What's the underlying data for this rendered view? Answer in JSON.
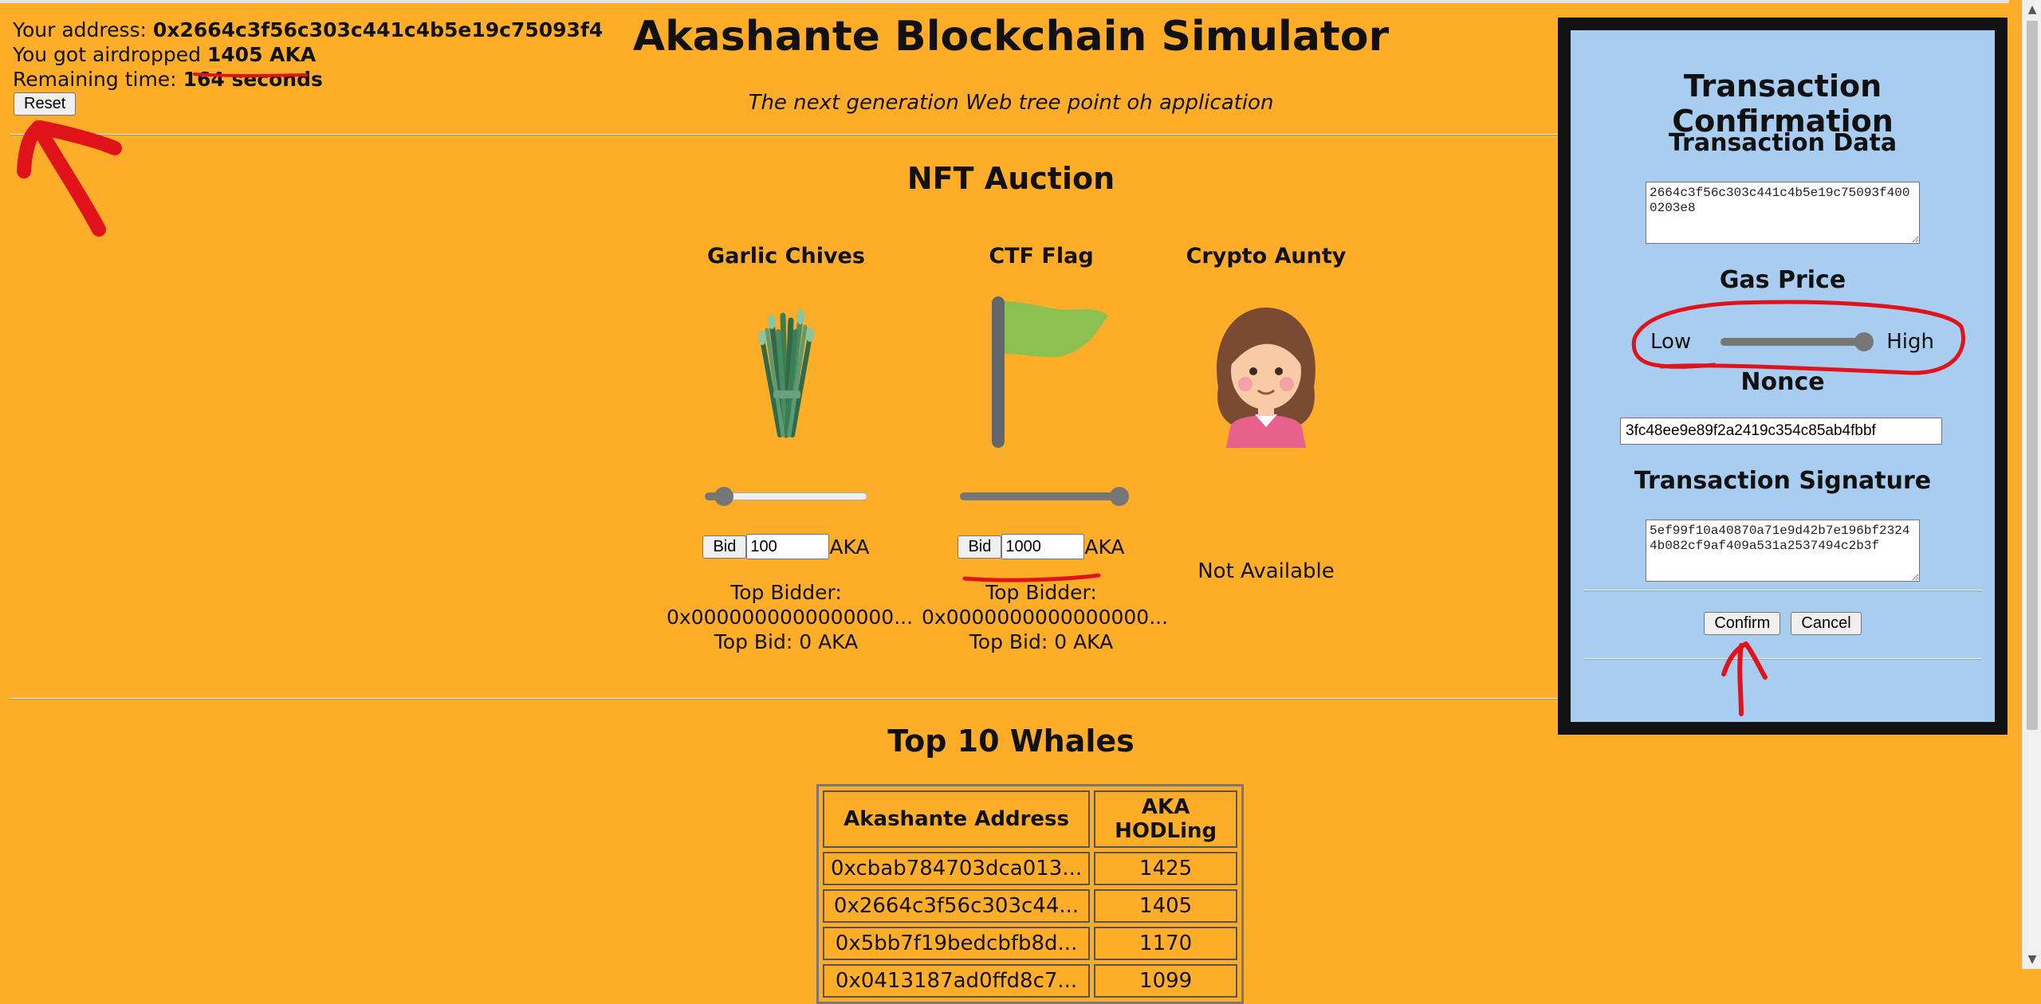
{
  "account": {
    "address_label": "Your address: ",
    "address": "0x2664c3f56c303c441c4b5e19c75093f4",
    "airdrop_label": "You got airdropped ",
    "airdrop_amount": "1405 AKA",
    "time_label": "Remaining time: ",
    "time_value": "164 seconds",
    "reset_label": "Reset"
  },
  "header": {
    "title": "Akashante Blockchain Simulator",
    "subtitle": "The next generation Web tree point oh application"
  },
  "auction": {
    "title": "NFT Auction",
    "items": [
      {
        "name": "Garlic Chives",
        "icon": "garlic-chives-icon",
        "bid_label": "Bid",
        "bid_value": "100",
        "currency": "AKA",
        "slider_level": 0.1,
        "top_bidder_label": "Top Bidder:",
        "top_bidder": "0x0000000000000000...",
        "top_bid": "Top Bid: 0 AKA"
      },
      {
        "name": "CTF Flag",
        "icon": "flag-icon",
        "bid_label": "Bid",
        "bid_value": "1000",
        "currency": "AKA",
        "slider_level": 1.0,
        "top_bidder_label": "Top Bidder:",
        "top_bidder": "0x0000000000000000...",
        "top_bid": "Top Bid: 0 AKA"
      },
      {
        "name": "Crypto Aunty",
        "icon": "crypto-aunty-icon",
        "status": "Not Available"
      }
    ]
  },
  "whales": {
    "title": "Top 10 Whales",
    "headers": [
      "Akashante Address",
      "AKA HODLing"
    ],
    "rows": [
      {
        "address": "0xcbab784703dca013...",
        "amount": "1425"
      },
      {
        "address": "0x2664c3f56c303c44...",
        "amount": "1405"
      },
      {
        "address": "0x5bb7f19bedcbfb8d...",
        "amount": "1170"
      },
      {
        "address": "0x0413187ad0ffd8c7...",
        "amount": "1099"
      }
    ]
  },
  "modal": {
    "title": "Transaction Confirmation",
    "data_label": "Transaction Data",
    "data_value": "2664c3f56c303c441c4b5e19c75093f4000203e8",
    "gas_label": "Gas Price",
    "gas_low": "Low",
    "gas_high": "High",
    "gas_level": 1.0,
    "nonce_label": "Nonce",
    "nonce_value": "3fc48ee9e89f2a2419c354c85ab4fbbf",
    "signature_label": "Transaction Signature",
    "signature_value": "5ef99f10a40870a71e9d42b7e196bf23244b082cf9af409a531a2537494c2b3f",
    "confirm_label": "Confirm",
    "cancel_label": "Cancel"
  },
  "colors": {
    "page_bg": "#fead29",
    "modal_bg": "#a9cdf0",
    "modal_border": "#121212",
    "annotation": "#e0131b"
  }
}
